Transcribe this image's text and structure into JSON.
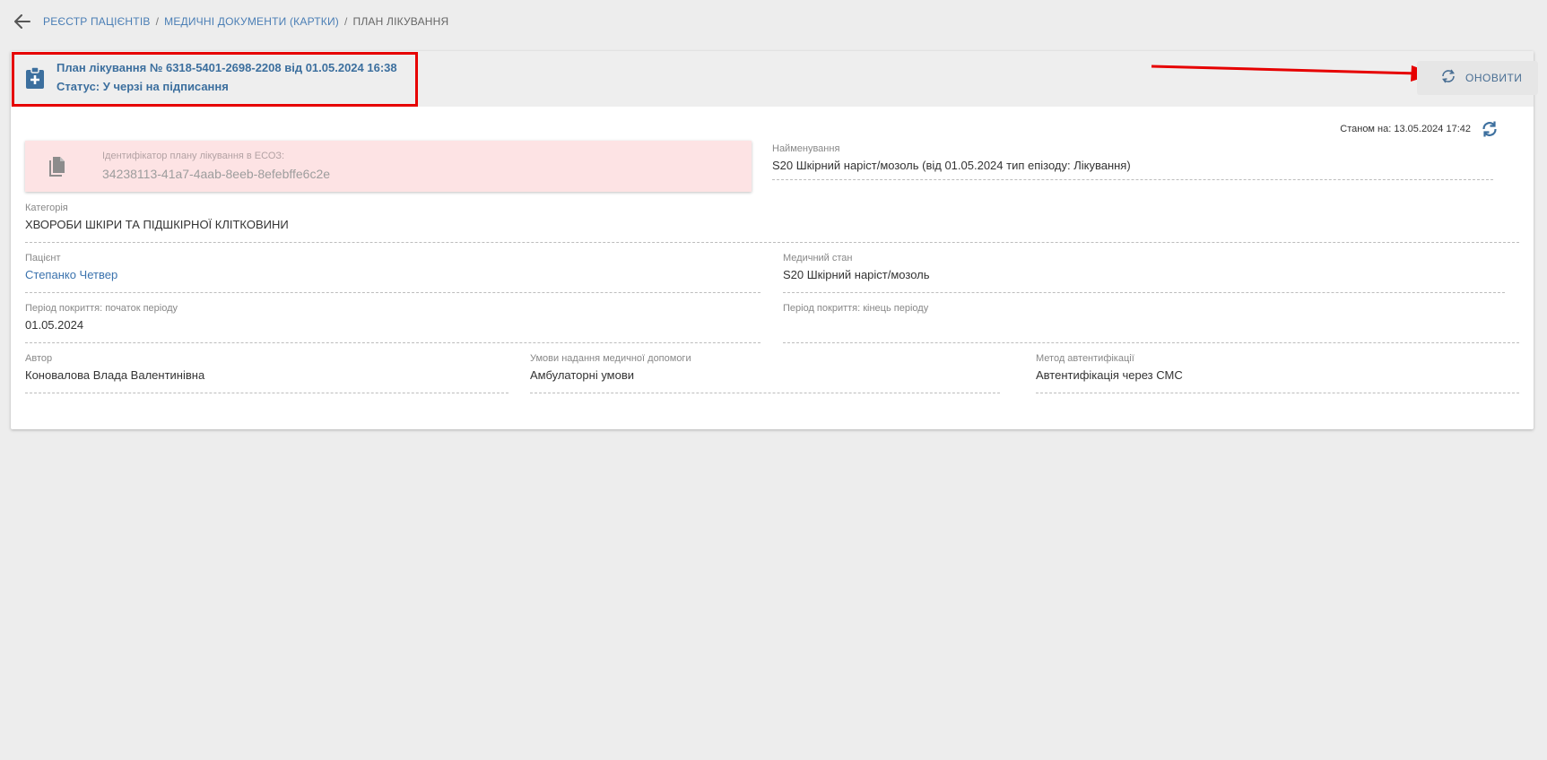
{
  "breadcrumb": {
    "items": [
      "РЕЄСТР ПАЦІЄНТІВ",
      "МЕДИЧНІ ДОКУМЕНТИ (КАРТКИ)"
    ],
    "separator": "/",
    "current": "ПЛАН ЛІКУВАННЯ"
  },
  "header": {
    "title": "План лікування № 6318-5401-2698-2208 від 01.05.2024 16:38",
    "status": "Статус: У черзі на підписання",
    "refresh_label": "ОНОВИТИ"
  },
  "as_of": "Станом на: 13.05.2024 17:42",
  "identifier": {
    "label": "Ідентифікатор плану лікування в ЕСОЗ:",
    "value": "34238113-41a7-4aab-8eeb-8efebffe6c2e"
  },
  "fields": {
    "name": {
      "label": "Найменування",
      "value": "S20 Шкірний наріст/мозоль (від 01.05.2024 тип епізоду: Лікування)"
    },
    "category": {
      "label": "Категорія",
      "value": "ХВОРОБИ ШКІРИ ТА ПІДШКІРНОЇ КЛІТКОВИНИ"
    },
    "patient": {
      "label": "Пацієнт",
      "value": "Степанко Четвер"
    },
    "condition": {
      "label": "Медичний стан",
      "value": "S20 Шкірний наріст/мозоль"
    },
    "period_start": {
      "label": "Період покриття: початок періоду",
      "value": "01.05.2024"
    },
    "period_end": {
      "label": "Період покриття: кінець періоду",
      "value": ""
    },
    "author": {
      "label": "Автор",
      "value": "Коновалова Влада Валентинівна"
    },
    "care_conditions": {
      "label": "Умови надання медичної допомоги",
      "value": "Амбулаторні умови"
    },
    "auth_method": {
      "label": "Метод автентифікації",
      "value": "Автентифікація через СМС"
    }
  },
  "colors": {
    "accent": "#3c6f9e",
    "link": "#3a72ad",
    "highlight": "#e60000",
    "id_box_bg": "#fde3e4",
    "page_bg": "#ededed"
  },
  "icons": [
    "back-arrow-icon",
    "clipboard-plus-icon",
    "refresh-icon",
    "copy-icon"
  ]
}
